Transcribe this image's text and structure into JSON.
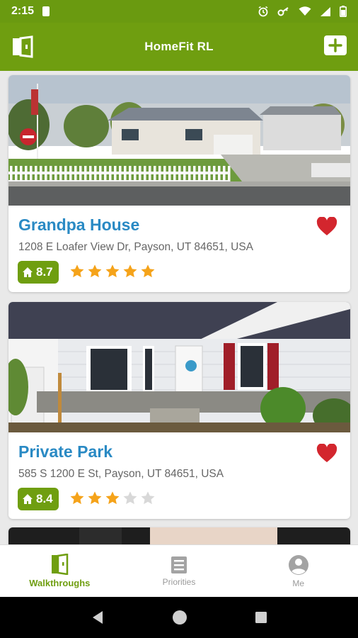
{
  "status_bar": {
    "time": "2:15"
  },
  "app_bar": {
    "title": "HomeFit RL"
  },
  "colors": {
    "brand_green": "#6f9e10",
    "title_blue": "#2a8ac4",
    "heart_red": "#d3262e",
    "star_gold": "#f5a31a",
    "star_empty": "#d8d8d8"
  },
  "listings": [
    {
      "name": "Grandpa House",
      "address": "1208 E Loafer View Dr, Payson, UT 84651, USA",
      "score": "8.7",
      "stars": 5,
      "favorite": true
    },
    {
      "name": "Private Park",
      "address": "585 S 1200 E St, Payson, UT 84651, USA",
      "score": "8.4",
      "stars": 3,
      "favorite": true
    }
  ],
  "bottom_nav": {
    "walkthroughs": "Walkthroughs",
    "priorities": "Priorities",
    "me": "Me"
  }
}
